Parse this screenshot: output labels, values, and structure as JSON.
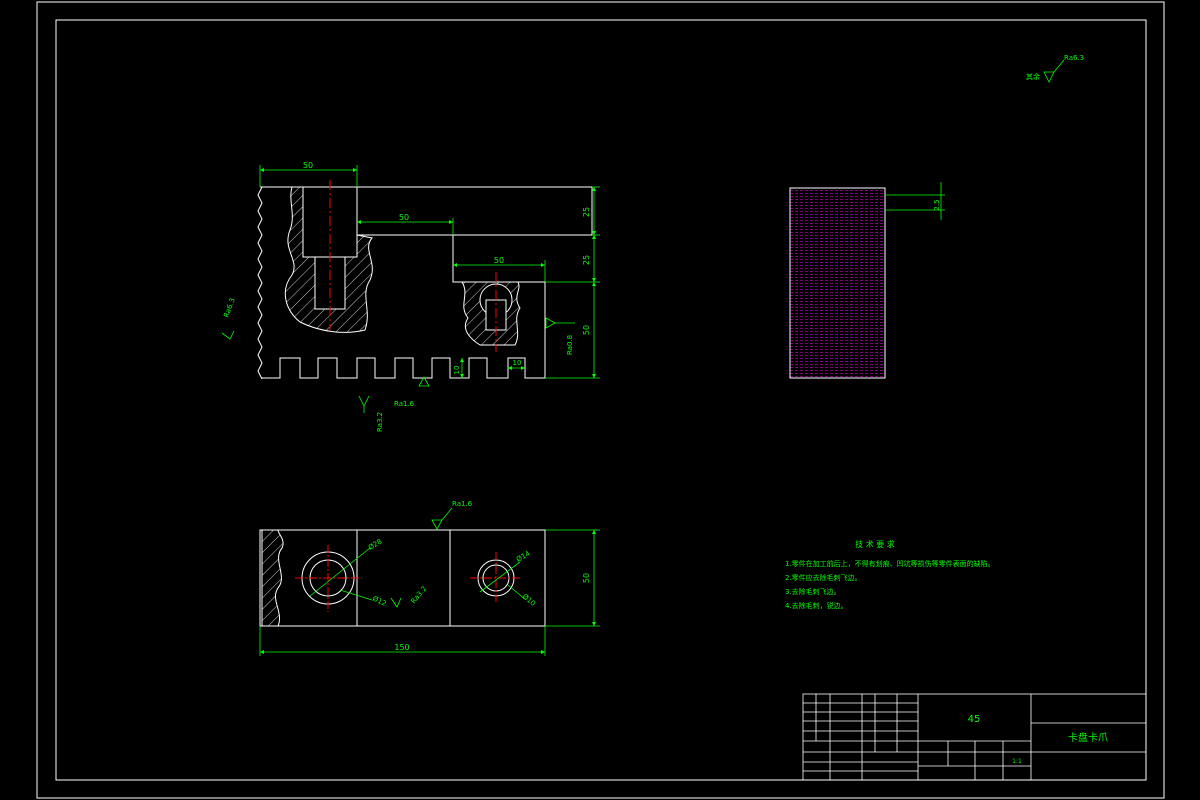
{
  "colors": {
    "background": "#000000",
    "outline": "#ffffff",
    "dimension": "#00ff00",
    "centerline": "#ff0000",
    "hatch": "#ff00ff",
    "title_text": "#00ff00"
  },
  "front_view": {
    "dim_top_width": "50",
    "dim_step_width": "50",
    "dim_slot_width": "50",
    "dim_right_h1": "25",
    "dim_right_h2": "25",
    "dim_right_h3": "50",
    "dim_tooth_h": "10",
    "dim_tooth_w": "10"
  },
  "side_view": {
    "dim_right": "2.5"
  },
  "top_view": {
    "dim_total_length": "150",
    "dim_height": "50",
    "dim_d28": "Ø28",
    "dim_d12": "Ø12",
    "dim_d14": "Ø14",
    "dim_d10": "Ø10"
  },
  "roughness": {
    "r1": "Ra6.3",
    "r2": "Ra3.2",
    "r3": "Ra1.6",
    "r4": "Ra0.8",
    "r5": "Ra1.6",
    "r6": "Ra3.2",
    "r_corner": "Ra6.3",
    "r_corner_label": "其余"
  },
  "tech_requirements": {
    "title": "技 术 要 求",
    "items": [
      "1.零件在加工前后上，不得有划痕、凹坑等损伤等零件表面的缺陷。",
      "2.零件应去除毛刺飞边。",
      "3.去除毛刺飞边。",
      "4.去除毛刺，锐边。"
    ]
  },
  "title_block": {
    "material": "45",
    "part_name": "卡盘卡爪",
    "scale": "1:1"
  }
}
